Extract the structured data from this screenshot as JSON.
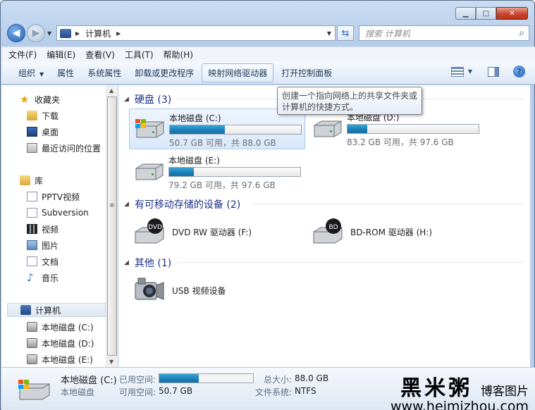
{
  "window": {
    "caption_buttons": {
      "minimize": "▁",
      "maximize": "□",
      "close": "✕"
    }
  },
  "address_bar": {
    "crumbs": [
      "计算机"
    ],
    "search_placeholder": "搜索 计算机"
  },
  "menu": [
    "文件(F)",
    "编辑(E)",
    "查看(V)",
    "工具(T)",
    "帮助(H)"
  ],
  "commands": [
    "组织",
    "属性",
    "系统属性",
    "卸载或更改程序",
    "映射网络驱动器",
    "打开控制面板"
  ],
  "tooltip": {
    "line1": "创建一个指向网络上的共享文件夹或",
    "line2": "计算机的快捷方式。"
  },
  "sidebar": {
    "favorites_header": "收藏夹",
    "favorites": [
      "下载",
      "桌面",
      "最近访问的位置"
    ],
    "libraries_header": "库",
    "libraries": [
      "PPTV视频",
      "Subversion",
      "视频",
      "图片",
      "文档",
      "音乐"
    ],
    "computer_header": "计算机",
    "drives": [
      "本地磁盘 (C:)",
      "本地磁盘 (D:)",
      "本地磁盘 (E:)"
    ]
  },
  "groups": {
    "hard_disks": "硬盘 (3)",
    "removable": "有可移动存储的设备 (2)",
    "other": "其他 (1)"
  },
  "drives": [
    {
      "name": "本地磁盘 (C:)",
      "info": "50.7 GB 可用，共 88.0 GB",
      "used_fraction": 0.42
    },
    {
      "name": "本地磁盘 (D:)",
      "info": "83.2 GB 可用，共 97.6 GB",
      "used_fraction": 0.15
    },
    {
      "name": "本地磁盘 (E:)",
      "info": "79.2 GB 可用，共 97.6 GB",
      "used_fraction": 0.19
    }
  ],
  "removable_devices": [
    {
      "name": "DVD RW 驱动器 (F:)",
      "badge": "DVD"
    },
    {
      "name": "BD-ROM 驱动器 (H:)",
      "badge": "BD"
    }
  ],
  "other_devices": [
    {
      "name": "USB 视频设备"
    }
  ],
  "details": {
    "name": "本地磁盘 (C:)",
    "type": "本地磁盘",
    "used_label": "已用空间:",
    "free_label": "可用空间:",
    "free_value": "50.7 GB",
    "total_label": "总大小:",
    "total_value": "88.0 GB",
    "fs_label": "文件系统:",
    "fs_value": "NTFS",
    "used_fraction": 0.42
  },
  "watermark": {
    "logo": "黑米粥",
    "blog": "博客图片",
    "url": "www.heimizhou.com"
  },
  "colors": {
    "progress": "#1a7eb6",
    "group_header": "#1e3287",
    "selection": "#d9e8fa"
  }
}
